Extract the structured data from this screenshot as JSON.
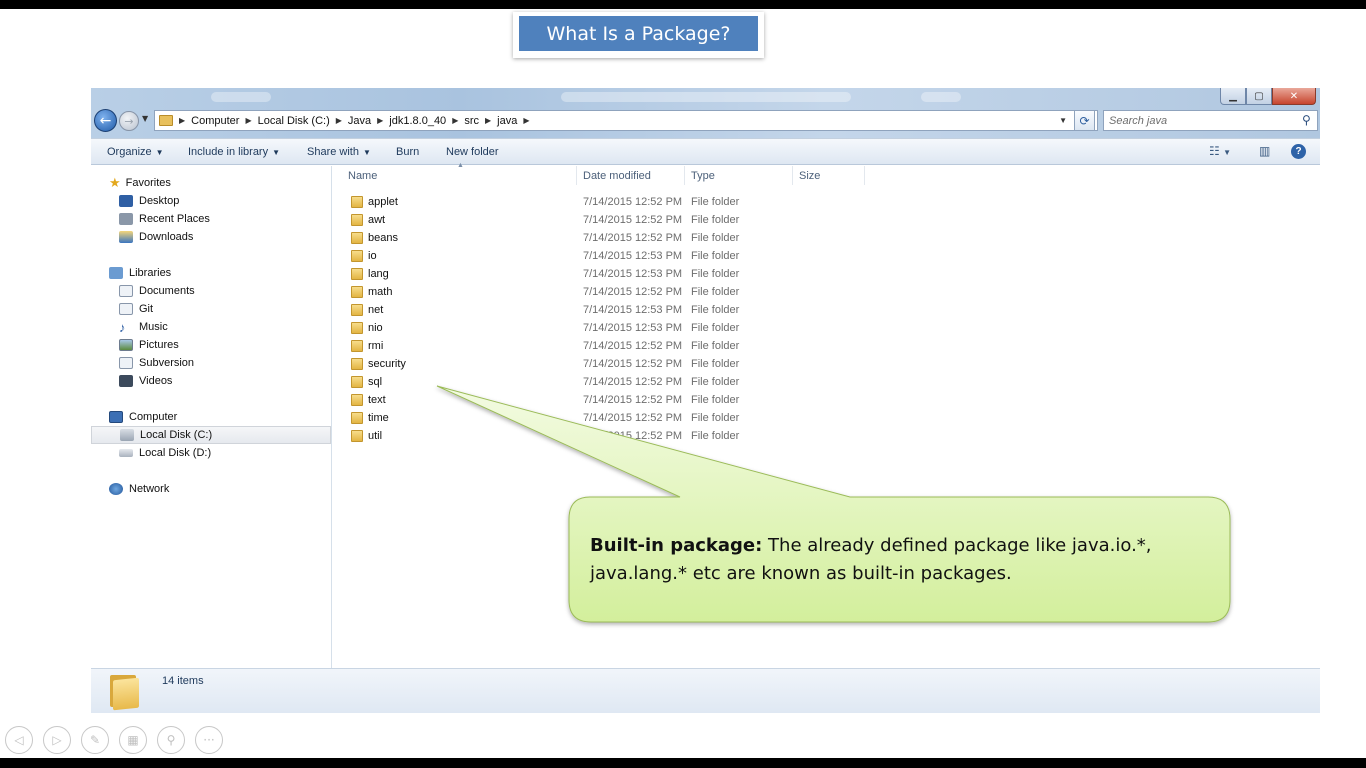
{
  "slide": {
    "title": "What Is a Package?",
    "callout": {
      "bold": "Built-in package:",
      "line1": " The already defined package like java.io.*,",
      "line2": "java.lang.* etc are known as built-in packages."
    },
    "controls": [
      {
        "name": "prev-slide-icon",
        "glyph": "◁"
      },
      {
        "name": "next-slide-icon",
        "glyph": "▷"
      },
      {
        "name": "pen-icon",
        "glyph": "✎"
      },
      {
        "name": "slides-icon",
        "glyph": "▦"
      },
      {
        "name": "zoom-icon",
        "glyph": "⚲"
      },
      {
        "name": "more-icon",
        "glyph": "···"
      }
    ]
  },
  "window": {
    "controls": {
      "minimize": "▁",
      "maximize": "▢",
      "close": "✕"
    },
    "address": {
      "crumbs": [
        "Computer",
        "Local Disk (C:)",
        "Java",
        "jdk1.8.0_40",
        "src",
        "java"
      ]
    },
    "search": {
      "placeholder": "Search java",
      "icon": "search-icon"
    },
    "toolbar": {
      "organize": "Organize",
      "include_in_library": "Include in library",
      "share_with": "Share with",
      "burn": "Burn",
      "new_folder": "New folder"
    },
    "nav": {
      "favorites": {
        "label": "Favorites",
        "items": [
          "Desktop",
          "Recent Places",
          "Downloads"
        ]
      },
      "libraries": {
        "label": "Libraries",
        "items": [
          "Documents",
          "Git",
          "Music",
          "Pictures",
          "Subversion",
          "Videos"
        ]
      },
      "computer": {
        "label": "Computer",
        "items": [
          "Local Disk (C:)",
          "Local Disk (D:)"
        ]
      },
      "network": {
        "label": "Network"
      }
    },
    "columns": [
      "Name",
      "Date modified",
      "Type",
      "Size"
    ],
    "files": [
      {
        "name": "applet",
        "date": "7/14/2015 12:52 PM",
        "type": "File folder"
      },
      {
        "name": "awt",
        "date": "7/14/2015 12:52 PM",
        "type": "File folder"
      },
      {
        "name": "beans",
        "date": "7/14/2015 12:52 PM",
        "type": "File folder"
      },
      {
        "name": "io",
        "date": "7/14/2015 12:53 PM",
        "type": "File folder"
      },
      {
        "name": "lang",
        "date": "7/14/2015 12:53 PM",
        "type": "File folder"
      },
      {
        "name": "math",
        "date": "7/14/2015 12:52 PM",
        "type": "File folder"
      },
      {
        "name": "net",
        "date": "7/14/2015 12:53 PM",
        "type": "File folder"
      },
      {
        "name": "nio",
        "date": "7/14/2015 12:53 PM",
        "type": "File folder"
      },
      {
        "name": "rmi",
        "date": "7/14/2015 12:52 PM",
        "type": "File folder"
      },
      {
        "name": "security",
        "date": "7/14/2015 12:52 PM",
        "type": "File folder"
      },
      {
        "name": "sql",
        "date": "7/14/2015 12:52 PM",
        "type": "File folder"
      },
      {
        "name": "text",
        "date": "7/14/2015 12:52 PM",
        "type": "File folder"
      },
      {
        "name": "time",
        "date": "7/14/2015 12:52 PM",
        "type": "File folder"
      },
      {
        "name": "util",
        "date": "7/14/2015 12:52 PM",
        "type": "File folder"
      }
    ],
    "status": {
      "count": "14 items"
    }
  }
}
